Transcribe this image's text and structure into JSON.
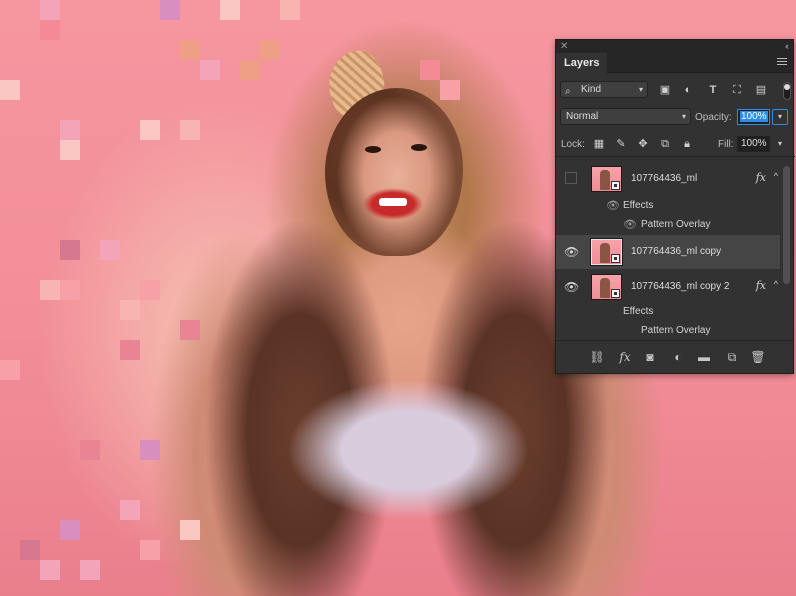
{
  "panel": {
    "title": "Layers",
    "close_icon": "close-icon",
    "collapse_icon": "collapse-icon"
  },
  "filter": {
    "kind_label": "Kind",
    "icons": [
      "image-filter-icon",
      "adjustment-filter-icon",
      "type-filter-icon",
      "shape-filter-icon",
      "smart-object-filter-icon"
    ]
  },
  "blend": {
    "mode": "Normal",
    "opacity_label": "Opacity:",
    "opacity_value": "100%"
  },
  "lock": {
    "label": "Lock:",
    "icons": [
      "lock-transparent-icon",
      "lock-image-icon",
      "lock-position-icon",
      "lock-artboard-icon",
      "lock-all-icon"
    ],
    "fill_label": "Fill:",
    "fill_value": "100%"
  },
  "layers": [
    {
      "name": "107764436_ml",
      "visible": false,
      "has_fx": true,
      "selected": false,
      "effects_label": "Effects",
      "effect": "Pattern Overlay"
    },
    {
      "name": "107764436_ml copy",
      "visible": true,
      "has_fx": false,
      "selected": true
    },
    {
      "name": "107764436_ml copy 2",
      "visible": true,
      "has_fx": true,
      "selected": false,
      "effects_label": "Effects",
      "effect": "Pattern Overlay"
    }
  ],
  "fx_badge": "fx",
  "bottom_icons": [
    "link-layers-icon",
    "fx-icon",
    "add-mask-icon",
    "adjustment-layer-icon",
    "new-group-icon",
    "new-layer-icon",
    "delete-layer-icon"
  ],
  "colors": {
    "canvas_background": "#f7959e",
    "panel_background": "#323232",
    "accent": "#2d8ceb"
  }
}
